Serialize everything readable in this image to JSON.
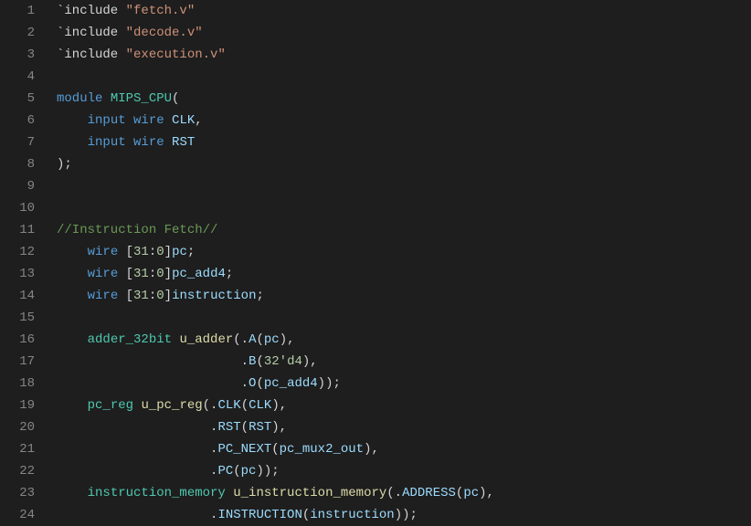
{
  "editor": {
    "language": "verilog",
    "lines": [
      {
        "num": 1,
        "tokens": [
          {
            "cls": "tok-plain",
            "t": "`include "
          },
          {
            "cls": "tok-string",
            "t": "\"fetch.v\""
          }
        ]
      },
      {
        "num": 2,
        "tokens": [
          {
            "cls": "tok-plain",
            "t": "`include "
          },
          {
            "cls": "tok-string",
            "t": "\"decode.v\""
          }
        ]
      },
      {
        "num": 3,
        "tokens": [
          {
            "cls": "tok-plain",
            "t": "`include "
          },
          {
            "cls": "tok-string",
            "t": "\"execution.v\""
          }
        ]
      },
      {
        "num": 4,
        "tokens": [
          {
            "cls": "tok-plain",
            "t": ""
          }
        ]
      },
      {
        "num": 5,
        "tokens": [
          {
            "cls": "tok-keyword",
            "t": "module"
          },
          {
            "cls": "tok-plain",
            "t": " "
          },
          {
            "cls": "tok-module",
            "t": "MIPS_CPU"
          },
          {
            "cls": "tok-plain",
            "t": "("
          }
        ]
      },
      {
        "num": 6,
        "tokens": [
          {
            "cls": "tok-plain",
            "t": "    "
          },
          {
            "cls": "tok-keyword",
            "t": "input"
          },
          {
            "cls": "tok-plain",
            "t": " "
          },
          {
            "cls": "tok-keyword",
            "t": "wire"
          },
          {
            "cls": "tok-plain",
            "t": " "
          },
          {
            "cls": "tok-ident",
            "t": "CLK"
          },
          {
            "cls": "tok-plain",
            "t": ","
          }
        ]
      },
      {
        "num": 7,
        "tokens": [
          {
            "cls": "tok-plain",
            "t": "    "
          },
          {
            "cls": "tok-keyword",
            "t": "input"
          },
          {
            "cls": "tok-plain",
            "t": " "
          },
          {
            "cls": "tok-keyword",
            "t": "wire"
          },
          {
            "cls": "tok-plain",
            "t": " "
          },
          {
            "cls": "tok-ident",
            "t": "RST"
          }
        ]
      },
      {
        "num": 8,
        "tokens": [
          {
            "cls": "tok-plain",
            "t": ");"
          }
        ]
      },
      {
        "num": 9,
        "tokens": [
          {
            "cls": "tok-plain",
            "t": ""
          }
        ]
      },
      {
        "num": 10,
        "tokens": [
          {
            "cls": "tok-plain",
            "t": ""
          }
        ]
      },
      {
        "num": 11,
        "tokens": [
          {
            "cls": "tok-comment",
            "t": "//Instruction Fetch//"
          }
        ]
      },
      {
        "num": 12,
        "tokens": [
          {
            "cls": "tok-plain",
            "t": "    "
          },
          {
            "cls": "tok-keyword",
            "t": "wire"
          },
          {
            "cls": "tok-plain",
            "t": " ["
          },
          {
            "cls": "tok-number",
            "t": "31"
          },
          {
            "cls": "tok-plain",
            "t": ":"
          },
          {
            "cls": "tok-number",
            "t": "0"
          },
          {
            "cls": "tok-plain",
            "t": "]"
          },
          {
            "cls": "tok-ident",
            "t": "pc"
          },
          {
            "cls": "tok-plain",
            "t": ";"
          }
        ]
      },
      {
        "num": 13,
        "tokens": [
          {
            "cls": "tok-plain",
            "t": "    "
          },
          {
            "cls": "tok-keyword",
            "t": "wire"
          },
          {
            "cls": "tok-plain",
            "t": " ["
          },
          {
            "cls": "tok-number",
            "t": "31"
          },
          {
            "cls": "tok-plain",
            "t": ":"
          },
          {
            "cls": "tok-number",
            "t": "0"
          },
          {
            "cls": "tok-plain",
            "t": "]"
          },
          {
            "cls": "tok-ident",
            "t": "pc_add4"
          },
          {
            "cls": "tok-plain",
            "t": ";"
          }
        ]
      },
      {
        "num": 14,
        "tokens": [
          {
            "cls": "tok-plain",
            "t": "    "
          },
          {
            "cls": "tok-keyword",
            "t": "wire"
          },
          {
            "cls": "tok-plain",
            "t": " ["
          },
          {
            "cls": "tok-number",
            "t": "31"
          },
          {
            "cls": "tok-plain",
            "t": ":"
          },
          {
            "cls": "tok-number",
            "t": "0"
          },
          {
            "cls": "tok-plain",
            "t": "]"
          },
          {
            "cls": "tok-ident",
            "t": "instruction"
          },
          {
            "cls": "tok-plain",
            "t": ";"
          }
        ]
      },
      {
        "num": 15,
        "tokens": [
          {
            "cls": "tok-plain",
            "t": ""
          }
        ]
      },
      {
        "num": 16,
        "tokens": [
          {
            "cls": "tok-plain",
            "t": "    "
          },
          {
            "cls": "tok-module",
            "t": "adder_32bit"
          },
          {
            "cls": "tok-plain",
            "t": " "
          },
          {
            "cls": "tok-func",
            "t": "u_adder"
          },
          {
            "cls": "tok-plain",
            "t": "(."
          },
          {
            "cls": "tok-ident",
            "t": "A"
          },
          {
            "cls": "tok-plain",
            "t": "("
          },
          {
            "cls": "tok-ident",
            "t": "pc"
          },
          {
            "cls": "tok-plain",
            "t": "),"
          }
        ]
      },
      {
        "num": 17,
        "tokens": [
          {
            "cls": "tok-plain",
            "t": "                        ."
          },
          {
            "cls": "tok-ident",
            "t": "B"
          },
          {
            "cls": "tok-plain",
            "t": "("
          },
          {
            "cls": "tok-number",
            "t": "32'd4"
          },
          {
            "cls": "tok-plain",
            "t": "),"
          }
        ]
      },
      {
        "num": 18,
        "tokens": [
          {
            "cls": "tok-plain",
            "t": "                        ."
          },
          {
            "cls": "tok-ident",
            "t": "O"
          },
          {
            "cls": "tok-plain",
            "t": "("
          },
          {
            "cls": "tok-ident",
            "t": "pc_add4"
          },
          {
            "cls": "tok-plain",
            "t": "));"
          }
        ]
      },
      {
        "num": 19,
        "tokens": [
          {
            "cls": "tok-plain",
            "t": "    "
          },
          {
            "cls": "tok-module",
            "t": "pc_reg"
          },
          {
            "cls": "tok-plain",
            "t": " "
          },
          {
            "cls": "tok-func",
            "t": "u_pc_reg"
          },
          {
            "cls": "tok-plain",
            "t": "(."
          },
          {
            "cls": "tok-ident",
            "t": "CLK"
          },
          {
            "cls": "tok-plain",
            "t": "("
          },
          {
            "cls": "tok-ident",
            "t": "CLK"
          },
          {
            "cls": "tok-plain",
            "t": "),"
          }
        ]
      },
      {
        "num": 20,
        "tokens": [
          {
            "cls": "tok-plain",
            "t": "                    ."
          },
          {
            "cls": "tok-ident",
            "t": "RST"
          },
          {
            "cls": "tok-plain",
            "t": "("
          },
          {
            "cls": "tok-ident",
            "t": "RST"
          },
          {
            "cls": "tok-plain",
            "t": "),"
          }
        ]
      },
      {
        "num": 21,
        "tokens": [
          {
            "cls": "tok-plain",
            "t": "                    ."
          },
          {
            "cls": "tok-ident",
            "t": "PC_NEXT"
          },
          {
            "cls": "tok-plain",
            "t": "("
          },
          {
            "cls": "tok-ident",
            "t": "pc_mux2_out"
          },
          {
            "cls": "tok-plain",
            "t": "),"
          }
        ]
      },
      {
        "num": 22,
        "tokens": [
          {
            "cls": "tok-plain",
            "t": "                    ."
          },
          {
            "cls": "tok-ident",
            "t": "PC"
          },
          {
            "cls": "tok-plain",
            "t": "("
          },
          {
            "cls": "tok-ident",
            "t": "pc"
          },
          {
            "cls": "tok-plain",
            "t": "));"
          }
        ]
      },
      {
        "num": 23,
        "tokens": [
          {
            "cls": "tok-plain",
            "t": "    "
          },
          {
            "cls": "tok-module",
            "t": "instruction_memory"
          },
          {
            "cls": "tok-plain",
            "t": " "
          },
          {
            "cls": "tok-func",
            "t": "u_instruction_memory"
          },
          {
            "cls": "tok-plain",
            "t": "(."
          },
          {
            "cls": "tok-ident",
            "t": "ADDRESS"
          },
          {
            "cls": "tok-plain",
            "t": "("
          },
          {
            "cls": "tok-ident",
            "t": "pc"
          },
          {
            "cls": "tok-plain",
            "t": "),"
          }
        ]
      },
      {
        "num": 24,
        "tokens": [
          {
            "cls": "tok-plain",
            "t": "                    ."
          },
          {
            "cls": "tok-ident",
            "t": "INSTRUCTION"
          },
          {
            "cls": "tok-plain",
            "t": "("
          },
          {
            "cls": "tok-ident",
            "t": "instruction"
          },
          {
            "cls": "tok-plain",
            "t": "));"
          }
        ]
      }
    ]
  }
}
